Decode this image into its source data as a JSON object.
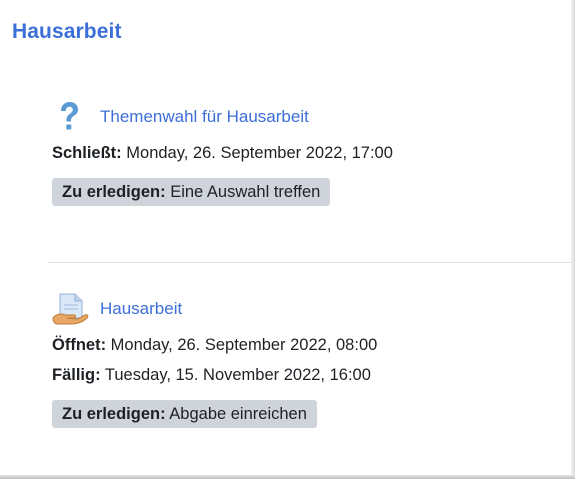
{
  "section": {
    "title": "Hausarbeit"
  },
  "activities": [
    {
      "icon": "question-mark-icon",
      "title": "Themenwahl für Hausarbeit",
      "dates": [
        {
          "label": "Schließt:",
          "value": "Monday, 26. September 2022, 17:00"
        }
      ],
      "todo": {
        "label": "Zu erledigen:",
        "value": "Eine Auswahl treffen"
      }
    },
    {
      "icon": "assignment-document-icon",
      "title": "Hausarbeit",
      "dates": [
        {
          "label": "Öffnet:",
          "value": "Monday, 26. September 2022, 08:00"
        },
        {
          "label": "Fällig:",
          "value": "Tuesday, 15. November 2022, 16:00"
        }
      ],
      "todo": {
        "label": "Zu erledigen:",
        "value": "Abgabe einreichen"
      }
    }
  ],
  "colors": {
    "link": "#3c6fd8",
    "badge_bg": "#ced4da",
    "question_icon": "#5b9bd5"
  }
}
